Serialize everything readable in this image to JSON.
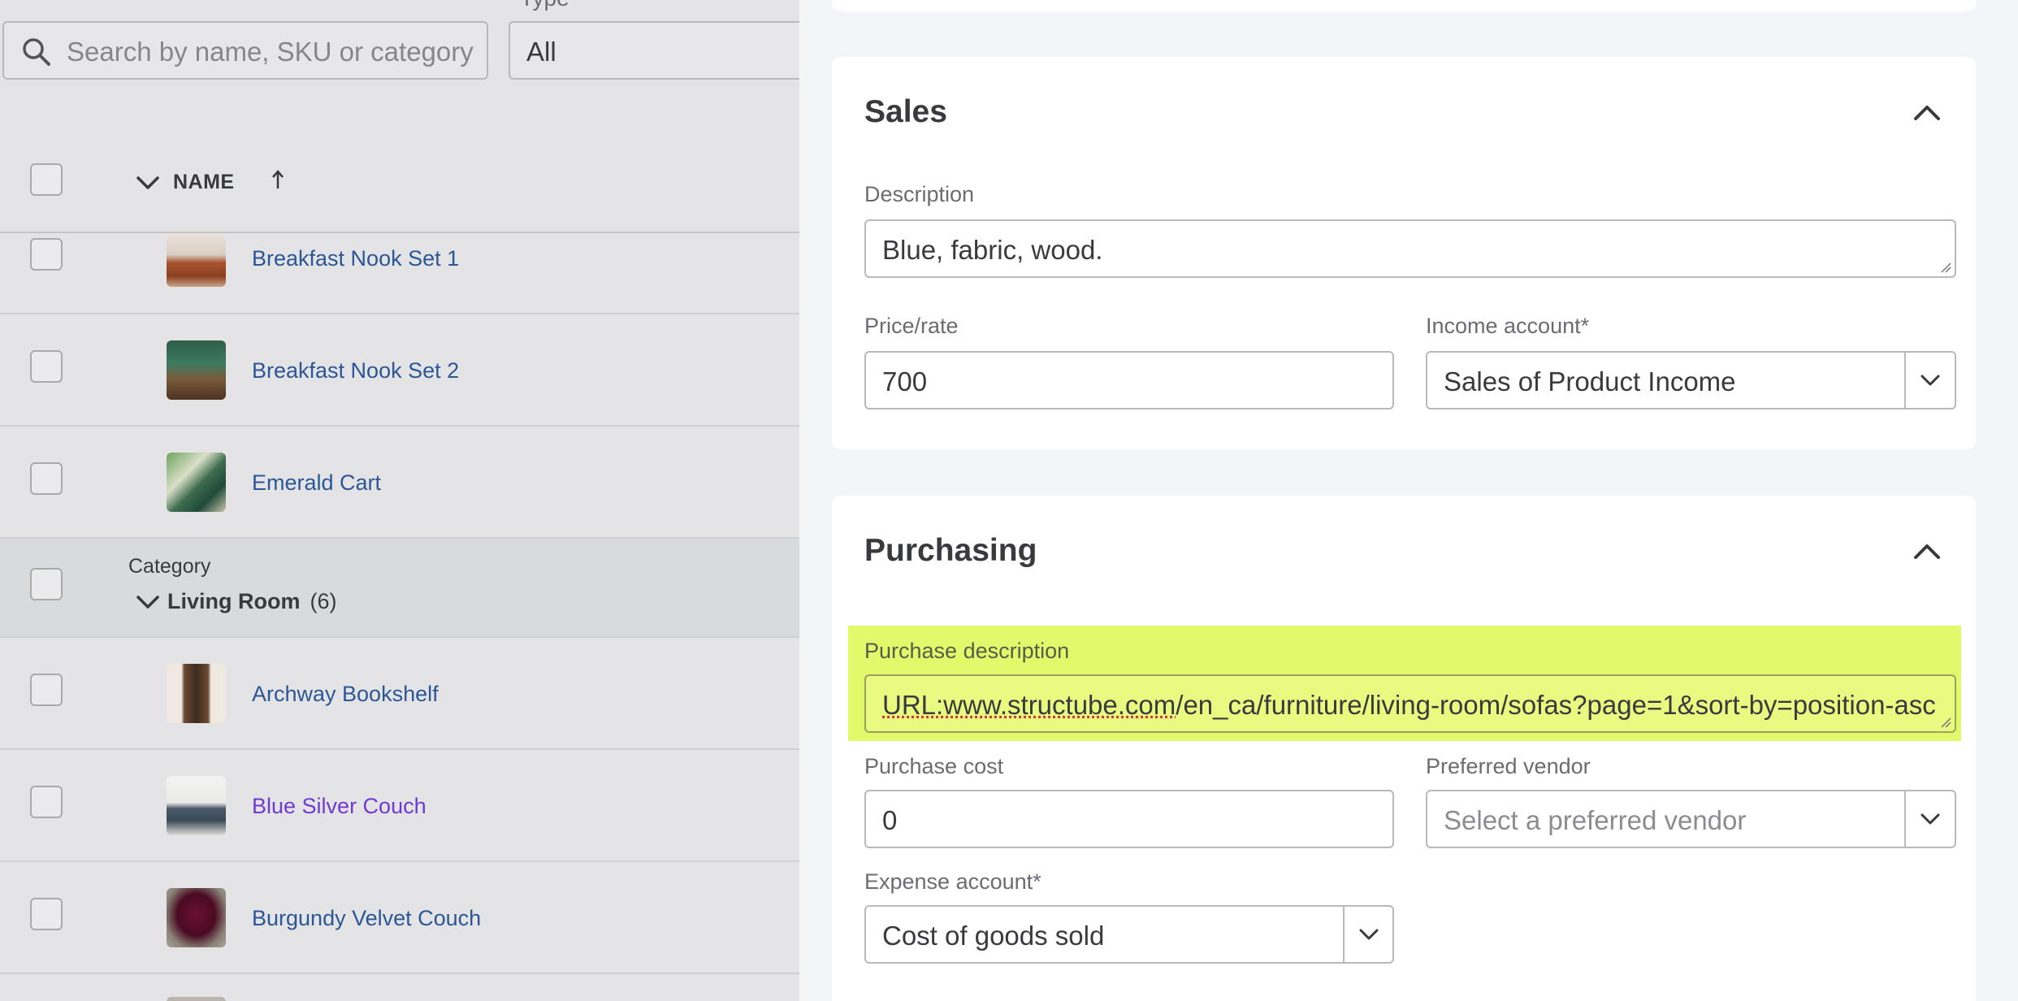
{
  "search": {
    "placeholder": "Search by name, SKU or category"
  },
  "filter": {
    "type_label": "Type",
    "type_value": "All"
  },
  "table": {
    "name_header": "NAME"
  },
  "rows": [
    {
      "name": "Breakfast Nook Set 1",
      "thumb": "dining-set-thumbnail"
    },
    {
      "name": "Breakfast Nook Set 2",
      "thumb": "dining-set-thumbnail"
    },
    {
      "name": "Emerald Cart",
      "thumb": "cart-thumbnail"
    }
  ],
  "category": {
    "label": "Category",
    "name": "Living Room",
    "count": "(6)"
  },
  "living_room_rows": [
    {
      "name": "Archway Bookshelf",
      "thumb": "bookshelf-thumbnail"
    },
    {
      "name": "Blue Silver Couch",
      "thumb": "couch-thumbnail"
    },
    {
      "name": "Burgundy Velvet Couch",
      "thumb": "couch-thumbnail"
    }
  ],
  "sales": {
    "title": "Sales",
    "description_label": "Description",
    "description_value": "Blue, fabric, wood.",
    "price_label": "Price/rate",
    "price_value": "700",
    "income_label": "Income account*",
    "income_value": "Sales of Product Income"
  },
  "purchasing": {
    "title": "Purchasing",
    "description_label": "Purchase description",
    "description_value_underlined": "URL:www.structube.com",
    "description_value_rest": "/en_ca/furniture/living-room/sofas?page=1&sort-by=position-asc",
    "cost_label": "Purchase cost",
    "cost_value": "0",
    "vendor_label": "Preferred vendor",
    "vendor_placeholder": "Select a preferred vendor",
    "expense_label": "Expense account*",
    "expense_value": "Cost of goods sold"
  },
  "colors": {
    "link": "#2b5797",
    "visited_link": "#6e3bd2",
    "highlight": "#e2f96b"
  }
}
